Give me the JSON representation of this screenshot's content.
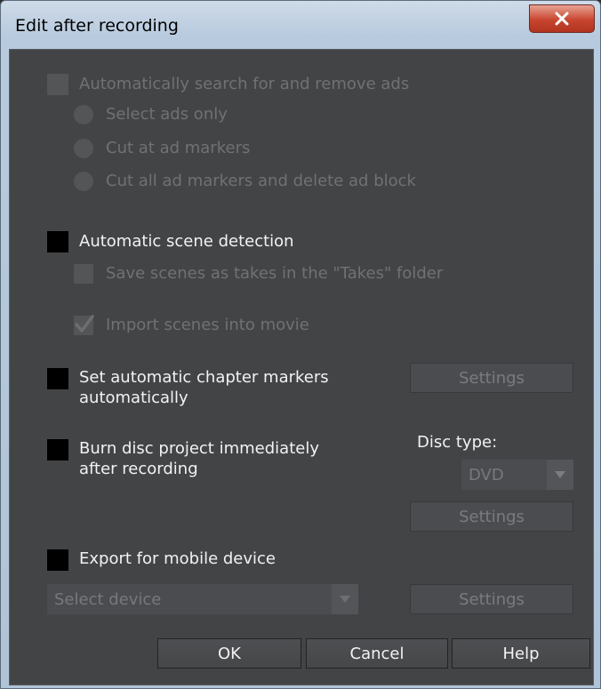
{
  "window": {
    "title": "Edit after recording",
    "close_label": "✕"
  },
  "ads": {
    "label": "Automatically search for and remove ads",
    "options": [
      "Select ads only",
      "Cut at ad markers",
      "Cut all ad markers and delete ad block"
    ]
  },
  "scene": {
    "label": "Automatic scene detection",
    "save_takes_label": "Save scenes as takes in the \"Takes\" folder",
    "import_label": "Import scenes into movie"
  },
  "chapter": {
    "label_line1": "Set automatic chapter markers",
    "label_line2": "automatically",
    "settings_label": "Settings"
  },
  "burn": {
    "label_line1": "Burn disc project immediately",
    "label_line2": "after recording",
    "disc_type_label": "Disc type:",
    "disc_type_value": "DVD",
    "settings_label": "Settings"
  },
  "export": {
    "label": "Export for mobile device",
    "device_placeholder": "Select device",
    "settings_label": "Settings"
  },
  "buttons": {
    "ok": "OK",
    "cancel": "Cancel",
    "help": "Help"
  },
  "colors": {
    "panel": "#434446",
    "close": "#c8452f"
  }
}
